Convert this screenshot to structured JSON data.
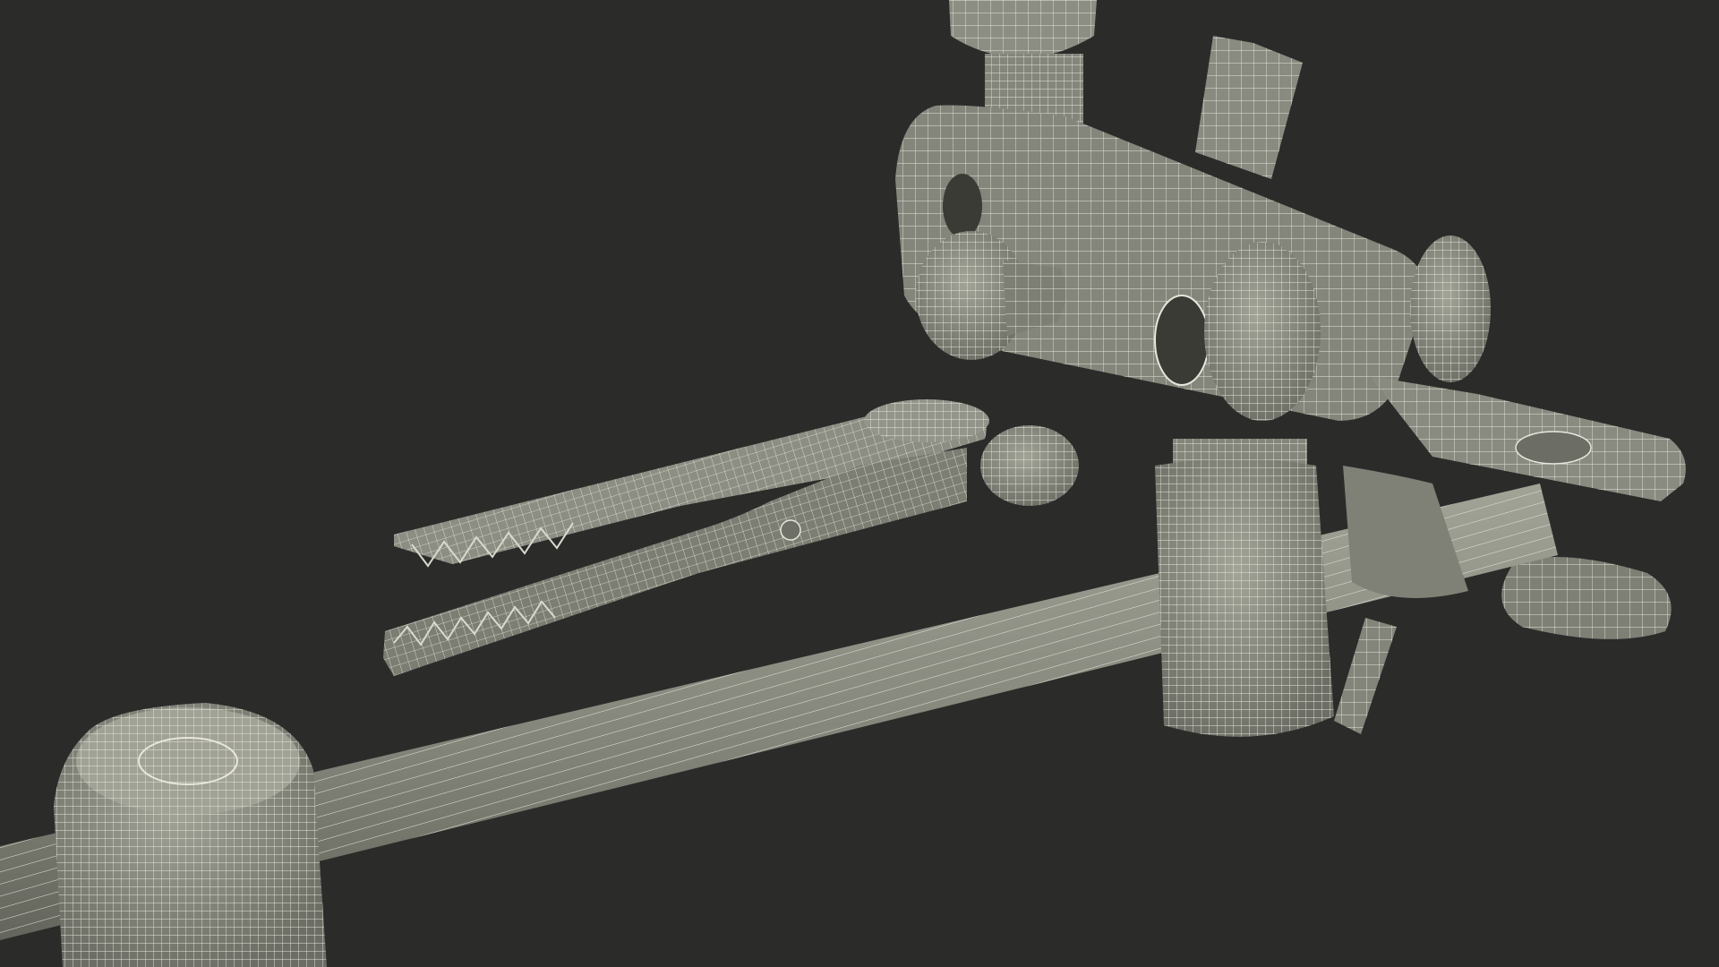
{
  "scene": {
    "subject": "wireframe-render-helping-hands-clamp",
    "colors": {
      "background": "#2b2b2a",
      "surface": "#85867b",
      "surface_light": "#9a9b90",
      "surface_dark": "#6a6b62",
      "wire": "#e8e8df",
      "shadow": "#24241f"
    },
    "parts": [
      "horizontal-rod",
      "left-end-knob",
      "alligator-clip",
      "swivel-joint",
      "upper-bracket-plate",
      "lower-arm-plate",
      "wing-nut-left",
      "wing-nut-right",
      "vertical-post",
      "top-cap",
      "square-bar"
    ]
  }
}
